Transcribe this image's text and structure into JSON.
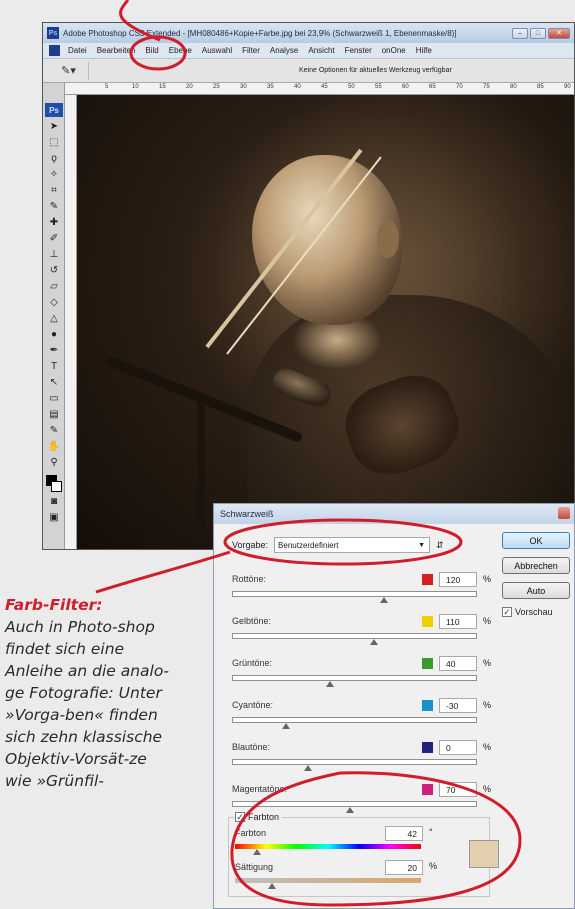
{
  "photoshop": {
    "app_badge": "Ps",
    "title": "Adobe Photoshop CS3 Extended - [MH080486+Kopie+Farbe.jpg bei 23,9% (Schwarzweiß 1, Ebenenmaske/8)]",
    "window_buttons": [
      "–",
      "□",
      "✕"
    ],
    "menu": [
      "Datei",
      "Bearbeiten",
      "Bild",
      "Ebene",
      "Auswahl",
      "Filter",
      "Analyse",
      "Ansicht",
      "Fenster",
      "onOne",
      "Hilfe"
    ],
    "options_text": "Keine Optionen für aktuelles Werkzeug verfügbar",
    "toolbox_badge": "Ps",
    "ruler_numbers": [
      "5",
      "10",
      "15",
      "20",
      "25",
      "30",
      "35",
      "40",
      "45",
      "50",
      "55",
      "60",
      "65",
      "70",
      "75",
      "80",
      "85",
      "90"
    ]
  },
  "caption": {
    "heading": "Farb-Filter:",
    "text": "Auch in Photo-shop findet sich eine Anleihe an die analo-ge Fotografie: Unter »Vorga-ben« finden sich zehn klassische Objektiv-Vorsät-ze wie »Grünfil-"
  },
  "dialog": {
    "title": "Schwarzweiß",
    "preset_label": "Vorgabe:",
    "preset_value": "Benutzerdefiniert",
    "sliders": [
      {
        "label": "Rottöne:",
        "value": "120",
        "unit": "%",
        "color": "#d42020",
        "level": 0.62
      },
      {
        "label": "Gelbtöne:",
        "value": "110",
        "unit": "%",
        "color": "#f0d000",
        "level": 0.58
      },
      {
        "label": "Grüntöne:",
        "value": "40",
        "unit": "%",
        "color": "#3a9a2a",
        "level": 0.4
      },
      {
        "label": "Cyantöne:",
        "value": "-30",
        "unit": "%",
        "color": "#1a90c8",
        "level": 0.22
      },
      {
        "label": "Blautöne:",
        "value": "0",
        "unit": "%",
        "color": "#23237a",
        "level": 0.31
      },
      {
        "label": "Magentatöne:",
        "value": "70",
        "unit": "%",
        "color": "#d0207a",
        "level": 0.48
      }
    ],
    "tint": {
      "checkbox_label": "Farbton",
      "checked": true,
      "hue_label": "Farbton",
      "hue_value": "42",
      "hue_unit": "°",
      "hue_level": 0.12,
      "sat_label": "Sättigung",
      "sat_value": "20",
      "sat_unit": "%",
      "sat_level": 0.2,
      "color": "#e2cfad"
    },
    "buttons": {
      "ok": "OK",
      "cancel": "Abbrechen",
      "auto": "Auto"
    },
    "preview_label": "Vorschau",
    "preview_checked": true
  },
  "annotation_color": "#d11c2a"
}
